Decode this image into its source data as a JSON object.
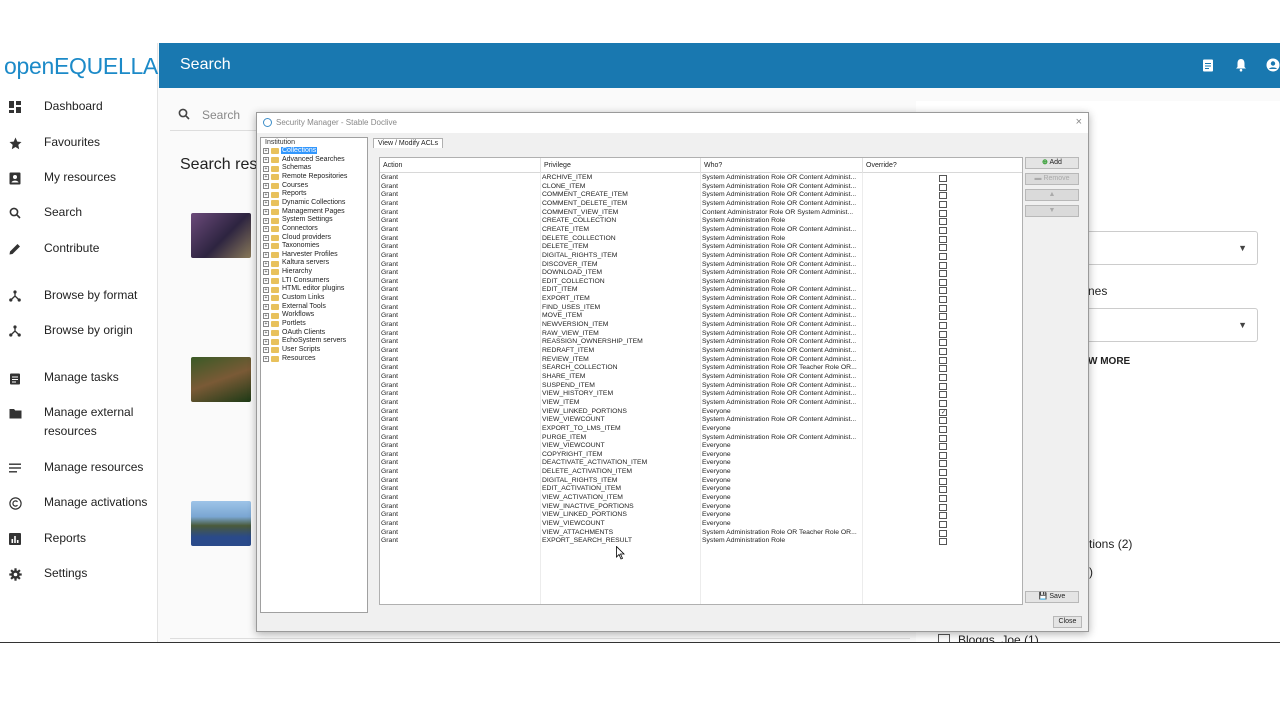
{
  "app": {
    "logo_open": "open",
    "logo_rest": "EQUELLA",
    "page_title": "Search"
  },
  "sidebar": {
    "items": [
      {
        "label": "Dashboard",
        "icon": "dashboard-icon"
      },
      {
        "label": "Favourites",
        "icon": "star-icon"
      },
      {
        "label": "My resources",
        "icon": "person-badge-icon"
      },
      {
        "label": "Search",
        "icon": "search-icon"
      },
      {
        "label": "Contribute",
        "icon": "pencil-icon"
      },
      {
        "label": "Browse by format",
        "icon": "hierarchy-icon"
      },
      {
        "label": "Browse by origin",
        "icon": "hierarchy-icon"
      },
      {
        "label": "Manage tasks",
        "icon": "clipboard-icon"
      },
      {
        "label": "Manage external resources",
        "icon": "folder-icon"
      },
      {
        "label": "Manage resources",
        "icon": "list-icon"
      },
      {
        "label": "Manage activations",
        "icon": "copyright-icon"
      },
      {
        "label": "Reports",
        "icon": "bar-chart-icon"
      },
      {
        "label": "Settings",
        "icon": "gear-icon"
      }
    ]
  },
  "search": {
    "placeholder": "Search",
    "results_title": "Search res"
  },
  "right_panel": {
    "partial_label": "nes",
    "show_more": "W MORE",
    "options_text": "tions",
    "options_count": "(2)",
    "partial_paren": ")",
    "owner_label": "Bloggs, Joe",
    "owner_count": "(1)"
  },
  "dialog": {
    "title": "Security Manager - Stable Doclive",
    "close_x": "×",
    "tab_label": "View / Modify ACLs",
    "tree_root": "Institution",
    "tree_items": [
      "Collections",
      "Advanced Searches",
      "Schemas",
      "Remote Repositories",
      "Courses",
      "Reports",
      "Dynamic Collections",
      "Management Pages",
      "System Settings",
      "Connectors",
      "Cloud providers",
      "Taxonomies",
      "Harvester Profiles",
      "Kaltura servers",
      "Hierarchy",
      "LTI Consumers",
      "HTML editor plugins",
      "Custom Links",
      "External Tools",
      "Workflows",
      "Portlets",
      "OAuth Clients",
      "EchoSystem servers",
      "User Scripts",
      "Resources"
    ],
    "columns": [
      "Action",
      "Privilege",
      "Who?",
      "Override?"
    ],
    "rows": [
      {
        "action": "Grant",
        "privilege": "ARCHIVE_ITEM",
        "who": "System Administration Role OR Content Administ...",
        "override": false
      },
      {
        "action": "Grant",
        "privilege": "CLONE_ITEM",
        "who": "System Administration Role OR Content Administ...",
        "override": false
      },
      {
        "action": "Grant",
        "privilege": "COMMENT_CREATE_ITEM",
        "who": "System Administration Role OR Content Administ...",
        "override": false
      },
      {
        "action": "Grant",
        "privilege": "COMMENT_DELETE_ITEM",
        "who": "System Administration Role OR Content Administ...",
        "override": false
      },
      {
        "action": "Grant",
        "privilege": "COMMENT_VIEW_ITEM",
        "who": "Content Administrator Role OR System Administ...",
        "override": false
      },
      {
        "action": "Grant",
        "privilege": "CREATE_COLLECTION",
        "who": "System Administration Role",
        "override": false
      },
      {
        "action": "Grant",
        "privilege": "CREATE_ITEM",
        "who": "System Administration Role OR Content Administ...",
        "override": false
      },
      {
        "action": "Grant",
        "privilege": "DELETE_COLLECTION",
        "who": "System Administration Role",
        "override": false
      },
      {
        "action": "Grant",
        "privilege": "DELETE_ITEM",
        "who": "System Administration Role OR Content Administ...",
        "override": false
      },
      {
        "action": "Grant",
        "privilege": "DIGITAL_RIGHTS_ITEM",
        "who": "System Administration Role OR Content Administ...",
        "override": false
      },
      {
        "action": "Grant",
        "privilege": "DISCOVER_ITEM",
        "who": "System Administration Role OR Content Administ...",
        "override": false
      },
      {
        "action": "Grant",
        "privilege": "DOWNLOAD_ITEM",
        "who": "System Administration Role OR Content Administ...",
        "override": false
      },
      {
        "action": "Grant",
        "privilege": "EDIT_COLLECTION",
        "who": "System Administration Role",
        "override": false
      },
      {
        "action": "Grant",
        "privilege": "EDIT_ITEM",
        "who": "System Administration Role OR Content Administ...",
        "override": false
      },
      {
        "action": "Grant",
        "privilege": "EXPORT_ITEM",
        "who": "System Administration Role OR Content Administ...",
        "override": false
      },
      {
        "action": "Grant",
        "privilege": "FIND_USES_ITEM",
        "who": "System Administration Role OR Content Administ...",
        "override": false
      },
      {
        "action": "Grant",
        "privilege": "MOVE_ITEM",
        "who": "System Administration Role OR Content Administ...",
        "override": false
      },
      {
        "action": "Grant",
        "privilege": "NEWVERSION_ITEM",
        "who": "System Administration Role OR Content Administ...",
        "override": false
      },
      {
        "action": "Grant",
        "privilege": "RAW_VIEW_ITEM",
        "who": "System Administration Role OR Content Administ...",
        "override": false
      },
      {
        "action": "Grant",
        "privilege": "REASSIGN_OWNERSHIP_ITEM",
        "who": "System Administration Role OR Content Administ...",
        "override": false
      },
      {
        "action": "Grant",
        "privilege": "REDRAFT_ITEM",
        "who": "System Administration Role OR Content Administ...",
        "override": false
      },
      {
        "action": "Grant",
        "privilege": "REVIEW_ITEM",
        "who": "System Administration Role OR Content Administ...",
        "override": false
      },
      {
        "action": "Grant",
        "privilege": "SEARCH_COLLECTION",
        "who": "System Administration Role OR Teacher Role OR...",
        "override": false
      },
      {
        "action": "Grant",
        "privilege": "SHARE_ITEM",
        "who": "System Administration Role OR Content Administ...",
        "override": false
      },
      {
        "action": "Grant",
        "privilege": "SUSPEND_ITEM",
        "who": "System Administration Role OR Content Administ...",
        "override": false
      },
      {
        "action": "Grant",
        "privilege": "VIEW_HISTORY_ITEM",
        "who": "System Administration Role OR Content Administ...",
        "override": false
      },
      {
        "action": "Grant",
        "privilege": "VIEW_ITEM",
        "who": "System Administration Role OR Content Administ...",
        "override": false
      },
      {
        "action": "Grant",
        "privilege": "VIEW_LINKED_PORTIONS",
        "who": "Everyone",
        "override": true
      },
      {
        "action": "Grant",
        "privilege": "VIEW_VIEWCOUNT",
        "who": "System Administration Role OR Content Administ...",
        "override": false
      },
      {
        "action": "Grant",
        "privilege": "EXPORT_TO_LMS_ITEM",
        "who": "Everyone",
        "override": false
      },
      {
        "action": "Grant",
        "privilege": "PURGE_ITEM",
        "who": "System Administration Role OR Content Administ...",
        "override": false
      },
      {
        "action": "Grant",
        "privilege": "VIEW_VIEWCOUNT",
        "who": "Everyone",
        "override": false
      },
      {
        "action": "Grant",
        "privilege": "COPYRIGHT_ITEM",
        "who": "Everyone",
        "override": false
      },
      {
        "action": "Grant",
        "privilege": "DEACTIVATE_ACTIVATION_ITEM",
        "who": "Everyone",
        "override": false
      },
      {
        "action": "Grant",
        "privilege": "DELETE_ACTIVATION_ITEM",
        "who": "Everyone",
        "override": false
      },
      {
        "action": "Grant",
        "privilege": "DIGITAL_RIGHTS_ITEM",
        "who": "Everyone",
        "override": false
      },
      {
        "action": "Grant",
        "privilege": "EDIT_ACTIVATION_ITEM",
        "who": "Everyone",
        "override": false
      },
      {
        "action": "Grant",
        "privilege": "VIEW_ACTIVATION_ITEM",
        "who": "Everyone",
        "override": false
      },
      {
        "action": "Grant",
        "privilege": "VIEW_INACTIVE_PORTIONS",
        "who": "Everyone",
        "override": false
      },
      {
        "action": "Grant",
        "privilege": "VIEW_LINKED_PORTIONS",
        "who": "Everyone",
        "override": false
      },
      {
        "action": "Grant",
        "privilege": "VIEW_VIEWCOUNT",
        "who": "Everyone",
        "override": false
      },
      {
        "action": "Grant",
        "privilege": "VIEW_ATTACHMENTS",
        "who": "System Administration Role OR Teacher Role OR...",
        "override": false
      },
      {
        "action": "Grant",
        "privilege": "EXPORT_SEARCH_RESULT",
        "who": "System Administration Role",
        "override": false
      }
    ],
    "buttons": {
      "add": "Add",
      "remove": "Remove",
      "save": "Save",
      "close": "Close"
    }
  },
  "colors": {
    "brand": "#1978b0",
    "logo": "#1c8ac8",
    "selection": "#3297fd"
  }
}
